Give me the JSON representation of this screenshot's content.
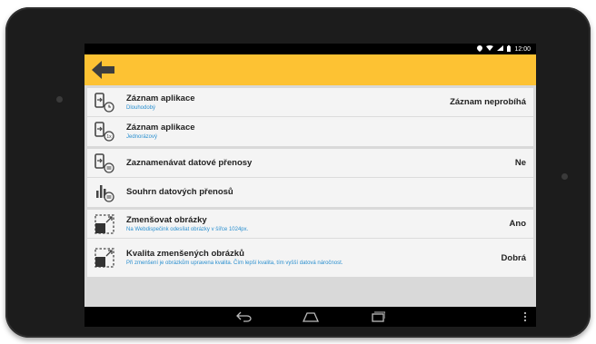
{
  "statusbar": {
    "time": "12:00",
    "icons": [
      "location-icon",
      "wifi-icon",
      "signal-icon",
      "battery-icon"
    ]
  },
  "actionbar": {
    "back_icon": "arrow-left-icon",
    "color": "#fdc233"
  },
  "cards": [
    {
      "rows": [
        {
          "title": "Záznam aplikace",
          "subtitle": "Dlouhodobý",
          "value": "Záznam neprobíhá",
          "icon": "phone-clock-icon"
        },
        {
          "title": "Záznam aplikace",
          "subtitle": "Jednorázový",
          "value": "",
          "icon": "phone-1x-icon"
        }
      ]
    },
    {
      "rows": [
        {
          "title": "Zaznamenávat datové přenosy",
          "subtitle": "",
          "value": "Ne",
          "icon": "phone-transfer-icon"
        },
        {
          "title": "Souhrn datových přenosů",
          "subtitle": "",
          "value": "",
          "icon": "bar-chart-icon"
        }
      ]
    },
    {
      "rows": [
        {
          "title": "Zmenšovat obrázky",
          "subtitle": "Na Webdispečink odesílat obrázky v šířce 1024px.",
          "value": "Ano",
          "icon": "resize-image-icon"
        },
        {
          "title": "Kvalita zmenšených obrázků",
          "subtitle": "Při zmenšení je obrázkům upravena kvalita. Čím lepší kvalita, tím vyšší datová náročnost.",
          "value": "Dobrá",
          "icon": "resize-quality-icon"
        }
      ]
    }
  ],
  "navbar": {
    "buttons": [
      "back-nav-icon",
      "home-nav-icon",
      "recents-nav-icon",
      "overflow-menu-icon"
    ]
  },
  "colors": {
    "accent": "#fdc233",
    "subtitle": "#2a8fcf"
  }
}
